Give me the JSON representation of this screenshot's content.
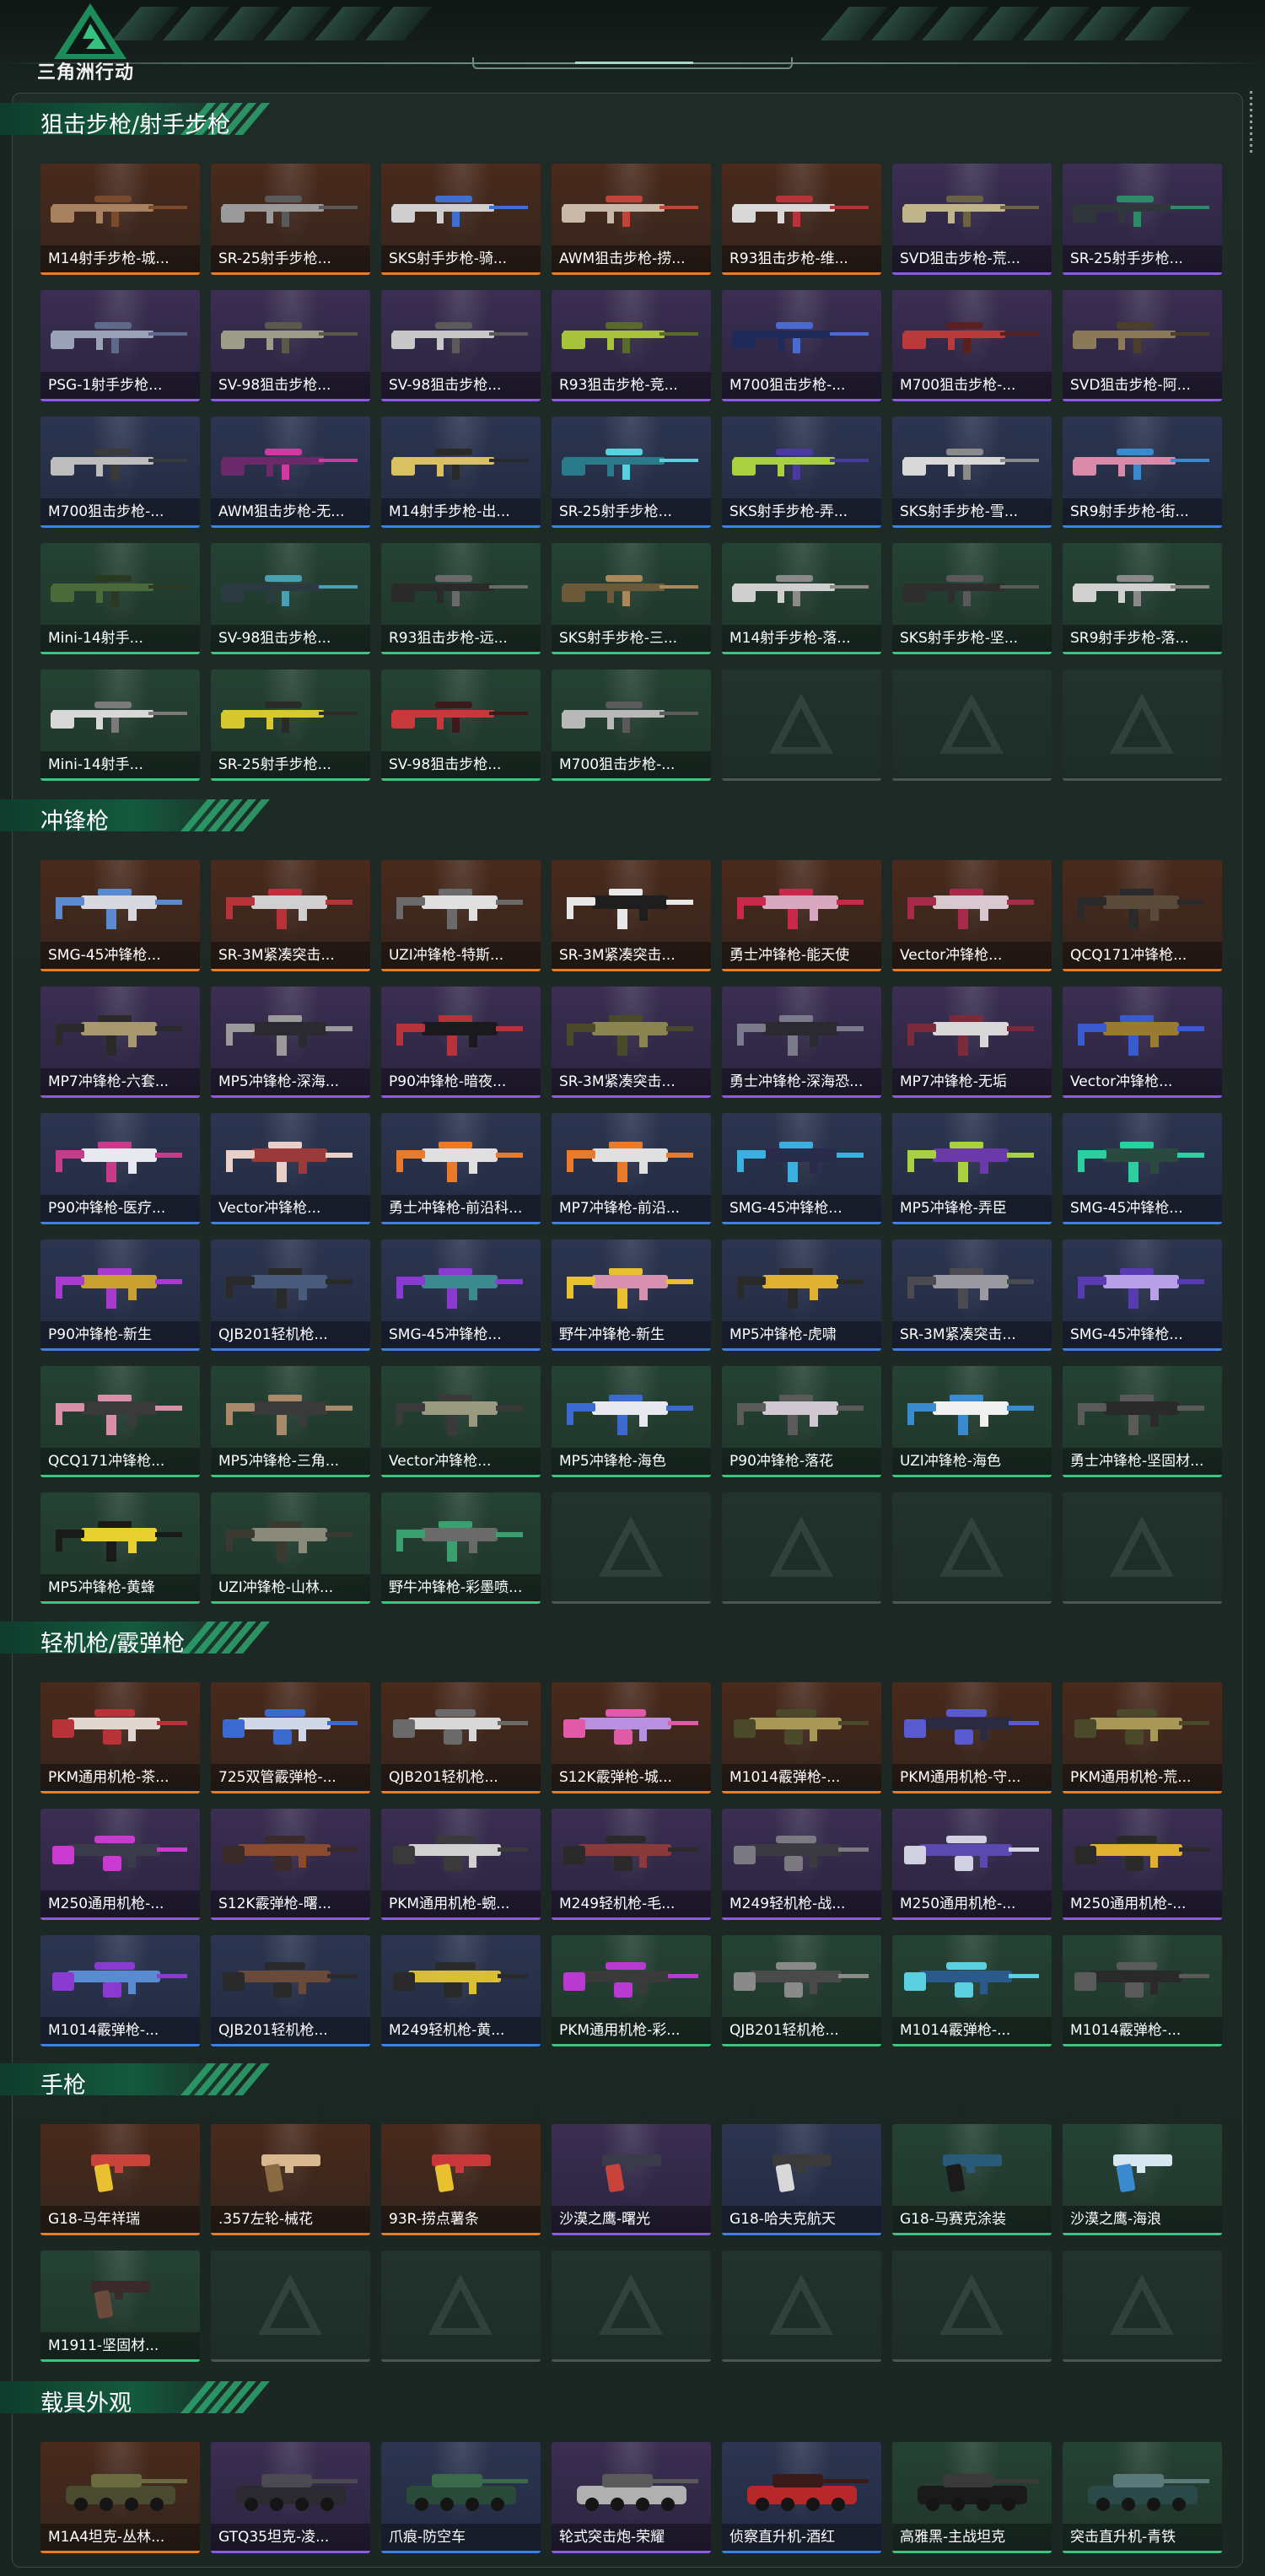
{
  "app": {
    "logo_text": "三角洲行动"
  },
  "colors": {
    "orange": "#e87d26",
    "purple": "#8b5ce0",
    "blue": "#3c82e6",
    "green": "#3fc380",
    "section_bar": "#145a3f",
    "background": "#1a2420"
  },
  "sections": [
    {
      "title": "狙击步枪/射手步枪",
      "item_kind": "rifle",
      "items": [
        {
          "label": "M14射手步枪-城...",
          "rarity": "orange",
          "body": "#a88260",
          "accent": "#7a4a2e"
        },
        {
          "label": "SR-25射手步枪...",
          "rarity": "orange",
          "body": "#9a9a9a",
          "accent": "#5a5a5a"
        },
        {
          "label": "SKS射手步枪-骑...",
          "rarity": "orange",
          "body": "#cfcfcf",
          "accent": "#3f6fd0"
        },
        {
          "label": "AWM狙击步枪-捞...",
          "rarity": "orange",
          "body": "#c9b9a8",
          "accent": "#c0443a"
        },
        {
          "label": "R93狙击步枪-维...",
          "rarity": "orange",
          "body": "#d9d9d9",
          "accent": "#b8323a"
        },
        {
          "label": "SVD狙击步枪-荒...",
          "rarity": "purple",
          "body": "#bfb48a",
          "accent": "#6b6246"
        },
        {
          "label": "SR-25射手步枪...",
          "rarity": "purple",
          "body": "#30363a",
          "accent": "#2f8a6a"
        },
        {
          "label": "PSG-1射手步枪...",
          "rarity": "purple",
          "body": "#9aa2b8",
          "accent": "#5e6a8a"
        },
        {
          "label": "SV-98狙击步枪...",
          "rarity": "purple",
          "body": "#9c9c88",
          "accent": "#5a5a4a"
        },
        {
          "label": "SV-98狙击步枪...",
          "rarity": "purple",
          "body": "#c8c8c8",
          "accent": "#5a5a5a"
        },
        {
          "label": "R93狙击步枪-竞...",
          "rarity": "purple",
          "body": "#a8c23a",
          "accent": "#5a6a2a"
        },
        {
          "label": "M700狙击步枪-...",
          "rarity": "purple",
          "body": "#1f2a5a",
          "accent": "#4a6ad0"
        },
        {
          "label": "M700狙击步枪-...",
          "rarity": "purple",
          "body": "#b83a3a",
          "accent": "#5a1f1f"
        },
        {
          "label": "SVD狙击步枪-阿...",
          "rarity": "purple",
          "body": "#8a7a5a",
          "accent": "#4a3f2a"
        },
        {
          "label": "M700狙击步枪-...",
          "rarity": "blue",
          "body": "#bdbdbd",
          "accent": "#3a3a3a"
        },
        {
          "label": "AWM狙击步枪-无...",
          "rarity": "blue",
          "body": "#6a2a6a",
          "accent": "#d03aa0"
        },
        {
          "label": "M14射手步枪-出...",
          "rarity": "blue",
          "body": "#d9c060",
          "accent": "#2a2a2a"
        },
        {
          "label": "SR-25射手步枪...",
          "rarity": "blue",
          "body": "#2a7a8a",
          "accent": "#5ad0e0"
        },
        {
          "label": "SKS射手步枪-弄...",
          "rarity": "blue",
          "body": "#a8d040",
          "accent": "#4a3aa0"
        },
        {
          "label": "SKS射手步枪-雪...",
          "rarity": "blue",
          "body": "#d8d8d8",
          "accent": "#8a8a8a"
        },
        {
          "label": "SR9射手步枪-街...",
          "rarity": "blue",
          "body": "#d88aa8",
          "accent": "#3a8ad0"
        },
        {
          "label": "Mini-14射手...",
          "rarity": "green",
          "body": "#4a6a3a",
          "accent": "#2a3a22"
        },
        {
          "label": "SV-98狙击步枪...",
          "rarity": "green",
          "body": "#2a3a40",
          "accent": "#4aa0b0"
        },
        {
          "label": "R93狙击步枪-远...",
          "rarity": "green",
          "body": "#2a2a2a",
          "accent": "#6a6a6a"
        },
        {
          "label": "SKS射手步枪-三...",
          "rarity": "green",
          "body": "#6a5a3a",
          "accent": "#a88a5a"
        },
        {
          "label": "M14射手步枪-落...",
          "rarity": "green",
          "body": "#cfcfcf",
          "accent": "#8a8a8a"
        },
        {
          "label": "SKS射手步枪-坚...",
          "rarity": "green",
          "body": "#2e2e2e",
          "accent": "#5a5a5a"
        },
        {
          "label": "SR9射手步枪-落...",
          "rarity": "green",
          "body": "#d0d0d0",
          "accent": "#8a8a8a"
        },
        {
          "label": "Mini-14射手...",
          "rarity": "green",
          "body": "#d8d8d8",
          "accent": "#7a7a7a"
        },
        {
          "label": "SR-25射手步枪...",
          "rarity": "green",
          "body": "#d8c830",
          "accent": "#2a2a2a"
        },
        {
          "label": "SV-98狙击步枪...",
          "rarity": "green",
          "body": "#c8383a",
          "accent": "#3a1a1a"
        },
        {
          "label": "M700狙击步枪-...",
          "rarity": "green",
          "body": "#b8b8b8",
          "accent": "#5a5a5a"
        }
      ],
      "empty_slots": 3
    },
    {
      "title": "冲锋枪",
      "item_kind": "smg",
      "items": [
        {
          "label": "SMG-45冲锋枪...",
          "rarity": "orange",
          "body": "#d8d8e0",
          "accent": "#5a8ad0"
        },
        {
          "label": "SR-3M紧凑突击...",
          "rarity": "orange",
          "body": "#d0d0d0",
          "accent": "#b8323a"
        },
        {
          "label": "UZI冲锋枪-特斯...",
          "rarity": "orange",
          "body": "#e0e0e0",
          "accent": "#6a6a6a"
        },
        {
          "label": "SR-3M紧凑突击...",
          "rarity": "orange",
          "body": "#1e1e1e",
          "accent": "#e8e8e8"
        },
        {
          "label": "勇士冲锋枪-能天使",
          "rarity": "orange",
          "body": "#d8a8c0",
          "accent": "#c8284a"
        },
        {
          "label": "Vector冲锋枪...",
          "rarity": "orange",
          "body": "#d8c8d0",
          "accent": "#a82a4a"
        },
        {
          "label": "QCQ171冲锋枪...",
          "rarity": "orange",
          "body": "#5a4a3a",
          "accent": "#2a2a2a"
        },
        {
          "label": "MP7冲锋枪-六套...",
          "rarity": "purple",
          "body": "#a89870",
          "accent": "#2a2a2a"
        },
        {
          "label": "MP5冲锋枪-深海...",
          "rarity": "purple",
          "body": "#2a2a30",
          "accent": "#9a9a9a"
        },
        {
          "label": "P90冲锋枪-暗夜...",
          "rarity": "purple",
          "body": "#1a1a1e",
          "accent": "#b8323a"
        },
        {
          "label": "SR-3M紧凑突击...",
          "rarity": "purple",
          "body": "#8a8450",
          "accent": "#4a4a2a"
        },
        {
          "label": "勇士冲锋枪-深海恐...",
          "rarity": "purple",
          "body": "#2a2a30",
          "accent": "#7a7a8a"
        },
        {
          "label": "MP7冲锋枪-无垢",
          "rarity": "purple",
          "body": "#d8d8d8",
          "accent": "#7a2a3a"
        },
        {
          "label": "Vector冲锋枪...",
          "rarity": "purple",
          "body": "#9a7a30",
          "accent": "#3a5ad0"
        },
        {
          "label": "P90冲锋枪-医疗...",
          "rarity": "blue",
          "body": "#e8e8f0",
          "accent": "#c83a8a"
        },
        {
          "label": "Vector冲锋枪...",
          "rarity": "blue",
          "body": "#9a3a3a",
          "accent": "#e8d0c8"
        },
        {
          "label": "勇士冲锋枪-前沿科...",
          "rarity": "blue",
          "body": "#e0e0e0",
          "accent": "#e87a2a"
        },
        {
          "label": "MP7冲锋枪-前沿...",
          "rarity": "blue",
          "body": "#e0e0e0",
          "accent": "#e87a2a"
        },
        {
          "label": "SMG-45冲锋枪...",
          "rarity": "blue",
          "body": "#2a2a4a",
          "accent": "#3ab0e0"
        },
        {
          "label": "MP5冲锋枪-弄臣",
          "rarity": "blue",
          "body": "#6a3aa8",
          "accent": "#a8d040"
        },
        {
          "label": "SMG-45冲锋枪...",
          "rarity": "blue",
          "body": "#2a4a40",
          "accent": "#2ad0a0"
        },
        {
          "label": "P90冲锋枪-新生",
          "rarity": "blue",
          "body": "#c8a030",
          "accent": "#a83ad0"
        },
        {
          "label": "QJB201轻机枪...",
          "rarity": "blue",
          "body": "#4a5a7a",
          "accent": "#2a2a2a"
        },
        {
          "label": "SMG-45冲锋枪...",
          "rarity": "blue",
          "body": "#3a8a90",
          "accent": "#8a3ad0"
        },
        {
          "label": "野牛冲锋枪-新生",
          "rarity": "blue",
          "body": "#d890b0",
          "accent": "#e8c030"
        },
        {
          "label": "MP5冲锋枪-虎啸",
          "rarity": "blue",
          "body": "#e0b030",
          "accent": "#2a2a2a"
        },
        {
          "label": "SR-3M紧凑突击...",
          "rarity": "blue",
          "body": "#9a9aa0",
          "accent": "#4a4a50"
        },
        {
          "label": "SMG-45冲锋枪...",
          "rarity": "blue",
          "body": "#b8a0e8",
          "accent": "#5a3ab0"
        },
        {
          "label": "QCQ171冲锋枪...",
          "rarity": "green",
          "body": "#3a3a3a",
          "accent": "#d890a8"
        },
        {
          "label": "MP5冲锋枪-三角...",
          "rarity": "green",
          "body": "#3a3a3a",
          "accent": "#a88a6a"
        },
        {
          "label": "Vector冲锋枪...",
          "rarity": "green",
          "body": "#9a9a80",
          "accent": "#3a3a3a"
        },
        {
          "label": "MP5冲锋枪-海色",
          "rarity": "green",
          "body": "#e8e8f0",
          "accent": "#3a6ad0"
        },
        {
          "label": "P90冲锋枪-落花",
          "rarity": "green",
          "body": "#d0c8d0",
          "accent": "#5a5a5a"
        },
        {
          "label": "UZI冲锋枪-海色",
          "rarity": "green",
          "body": "#f0f0f0",
          "accent": "#3a8ad0"
        },
        {
          "label": "勇士冲锋枪-坚固材...",
          "rarity": "green",
          "body": "#2a2a2a",
          "accent": "#5a5a5a"
        },
        {
          "label": "MP5冲锋枪-黄蜂",
          "rarity": "green",
          "body": "#e8d030",
          "accent": "#1a1a1a"
        },
        {
          "label": "UZI冲锋枪-山林...",
          "rarity": "green",
          "body": "#8a8a7a",
          "accent": "#3a3a30"
        },
        {
          "label": "野牛冲锋枪-彩墨喷...",
          "rarity": "green",
          "body": "#6a6a6a",
          "accent": "#3aa070"
        }
      ],
      "empty_slots": 4
    },
    {
      "title": "轻机枪/霰弹枪",
      "item_kind": "lmg",
      "items": [
        {
          "label": "PKM通用机枪-茶...",
          "rarity": "orange",
          "body": "#e0d8d0",
          "accent": "#b8323a"
        },
        {
          "label": "725双管霰弹枪-...",
          "rarity": "orange",
          "body": "#d0d8e8",
          "accent": "#3a6ad0"
        },
        {
          "label": "QJB201轻机枪...",
          "rarity": "orange",
          "body": "#d8d8d8",
          "accent": "#6a6a6a"
        },
        {
          "label": "S12K霰弹枪-城...",
          "rarity": "orange",
          "body": "#b890e0",
          "accent": "#e05aa8"
        },
        {
          "label": "M1014霰弹枪-...",
          "rarity": "orange",
          "body": "#a89858",
          "accent": "#4a4a2a"
        },
        {
          "label": "PKM通用机枪-守...",
          "rarity": "orange",
          "body": "#2a2a40",
          "accent": "#5a5ad0"
        },
        {
          "label": "PKM通用机枪-荒...",
          "rarity": "orange",
          "body": "#a89858",
          "accent": "#4a4a2a"
        },
        {
          "label": "M250通用机枪-...",
          "rarity": "purple",
          "body": "#3a3a4a",
          "accent": "#c83ad0"
        },
        {
          "label": "S12K霰弹枪-曙...",
          "rarity": "purple",
          "body": "#8a4a30",
          "accent": "#3a2a2a"
        },
        {
          "label": "PKM通用机枪-蜿...",
          "rarity": "purple",
          "body": "#d0d0d0",
          "accent": "#3a3a3a"
        },
        {
          "label": "M249轻机枪-毛...",
          "rarity": "purple",
          "body": "#8a3a3a",
          "accent": "#2a2a2a"
        },
        {
          "label": "M249轻机枪-战...",
          "rarity": "purple",
          "body": "#3a3a40",
          "accent": "#7a7a80"
        },
        {
          "label": "M250通用机枪-...",
          "rarity": "purple",
          "body": "#5a4ab0",
          "accent": "#d0d0e0"
        },
        {
          "label": "M250通用机枪-...",
          "rarity": "purple",
          "body": "#e0b030",
          "accent": "#2a2a2a"
        },
        {
          "label": "M1014霰弹枪-...",
          "rarity": "blue",
          "body": "#5a8ad0",
          "accent": "#8a3ad0"
        },
        {
          "label": "QJB201轻机枪...",
          "rarity": "blue",
          "body": "#6a4a3a",
          "accent": "#2a2a2a"
        },
        {
          "label": "M249轻机枪-黄...",
          "rarity": "blue",
          "body": "#d8c030",
          "accent": "#2a2a2a"
        },
        {
          "label": "PKM通用机枪-彩...",
          "rarity": "green",
          "body": "#3a3a3a",
          "accent": "#b83ad0"
        },
        {
          "label": "QJB201轻机枪...",
          "rarity": "green",
          "body": "#4a4a4a",
          "accent": "#8a8a8a"
        },
        {
          "label": "M1014霰弹枪-...",
          "rarity": "green",
          "body": "#2a5a8a",
          "accent": "#5ad0e0"
        },
        {
          "label": "M1014霰弹枪-...",
          "rarity": "green",
          "body": "#2a2a2a",
          "accent": "#5a5a5a"
        }
      ],
      "empty_slots": 0
    },
    {
      "title": "手枪",
      "item_kind": "pistol",
      "items": [
        {
          "label": "G18-马年祥瑞",
          "rarity": "orange",
          "body": "#c8443a",
          "accent": "#e8c030"
        },
        {
          "label": ".357左轮-械花",
          "rarity": "orange",
          "body": "#d8b890",
          "accent": "#8a6a40"
        },
        {
          "label": "93R-捞点薯条",
          "rarity": "orange",
          "body": "#c8383a",
          "accent": "#e8c030"
        },
        {
          "label": "沙漠之鹰-曙光",
          "rarity": "purple",
          "body": "#3a3a4a",
          "accent": "#c8443a"
        },
        {
          "label": "G18-哈夫克航天",
          "rarity": "blue",
          "body": "#3a3a3a",
          "accent": "#d8d8d8"
        },
        {
          "label": "G18-马赛克涂装",
          "rarity": "green",
          "body": "#2a5a7a",
          "accent": "#1a1a1a"
        },
        {
          "label": "沙漠之鹰-海浪",
          "rarity": "green",
          "body": "#d8e8f0",
          "accent": "#3a8ad0"
        },
        {
          "label": "M1911-坚固材...",
          "rarity": "green",
          "body": "#3a2a2a",
          "accent": "#6a4a3a"
        }
      ],
      "empty_slots": 6
    },
    {
      "title": "载具外观",
      "item_kind": "vehicle",
      "items": [
        {
          "label": "M1A4坦克-丛林...",
          "rarity": "orange",
          "body": "#4a4a30",
          "accent": "#6a6a40"
        },
        {
          "label": "GTQ35坦克-凌...",
          "rarity": "purple",
          "body": "#2a2a30",
          "accent": "#4a4a50"
        },
        {
          "label": "爪痕-防空车",
          "rarity": "blue",
          "body": "#2a4a3a",
          "accent": "#3a6a4a"
        },
        {
          "label": "轮式突击炮-荣耀",
          "rarity": "purple",
          "body": "#b0b0b0",
          "accent": "#5a5a5a"
        },
        {
          "label": "侦察直升机-酒红",
          "rarity": "blue",
          "body": "#b8282a",
          "accent": "#3a1a1a"
        },
        {
          "label": "高雅黑-主战坦克",
          "rarity": "green",
          "body": "#1a1a1a",
          "accent": "#3a3a3a"
        },
        {
          "label": "突击直升机-青铁",
          "rarity": "green",
          "body": "#2a4a4a",
          "accent": "#5a7a7a"
        }
      ],
      "empty_slots": 0
    }
  ]
}
